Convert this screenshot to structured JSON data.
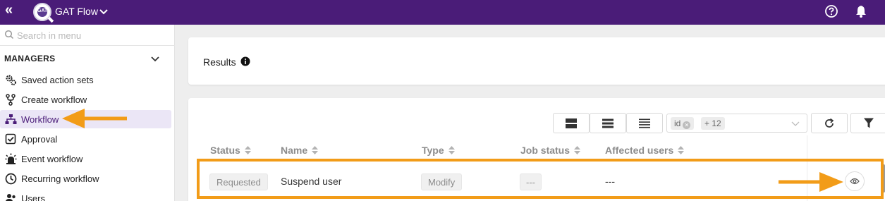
{
  "topbar": {
    "app_name": "GAT Flow",
    "logo_text": "GAT"
  },
  "sidebar": {
    "search_placeholder": "Search in menu",
    "section_title": "MANAGERS",
    "items": [
      {
        "label": "Saved action sets",
        "icon": "gears-icon"
      },
      {
        "label": "Create workflow",
        "icon": "branch-icon"
      },
      {
        "label": "Workflow",
        "icon": "sitemap-icon",
        "active": true
      },
      {
        "label": "Approval",
        "icon": "checkbox-icon"
      },
      {
        "label": "Event workflow",
        "icon": "alarm-icon"
      },
      {
        "label": "Recurring workflow",
        "icon": "clock-icon"
      },
      {
        "label": "Users",
        "icon": "users-icon"
      }
    ]
  },
  "results": {
    "title": "Results"
  },
  "toolbar": {
    "column_chips": [
      {
        "label": "id"
      },
      {
        "label": "+ 12"
      }
    ]
  },
  "table": {
    "headers": [
      "Status",
      "Name",
      "Type",
      "Job status",
      "Affected users"
    ],
    "rows": [
      {
        "status": "Requested",
        "name": "Suspend user",
        "type": "Modify",
        "job_status": "---",
        "affected_users": "---"
      }
    ]
  },
  "colors": {
    "topbar": "#4a1c78",
    "accent": "#f29c18",
    "active_bg": "#ebe6f6"
  }
}
